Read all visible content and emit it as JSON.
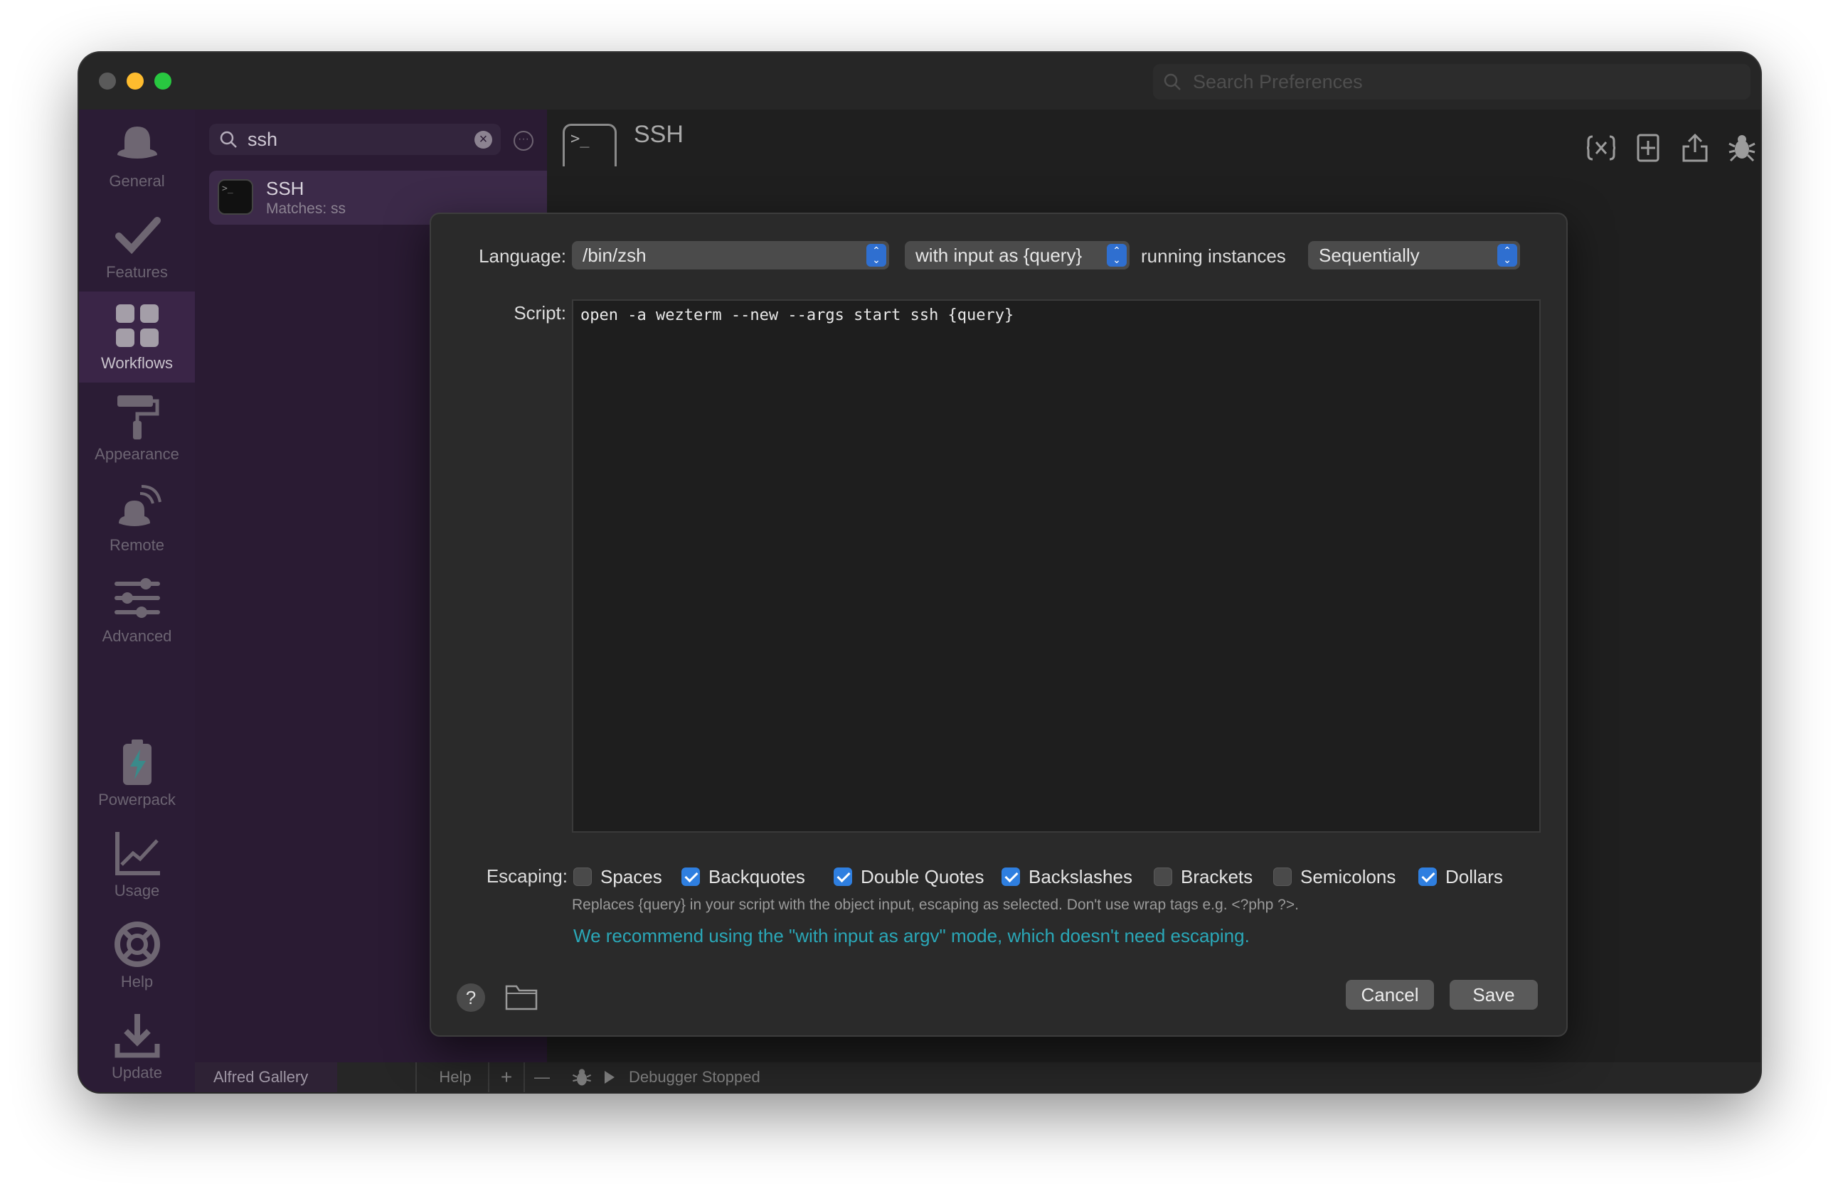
{
  "window": {
    "search_placeholder": "Search Preferences"
  },
  "sidebar": {
    "items": [
      {
        "label": "General",
        "icon": "hat-icon"
      },
      {
        "label": "Features",
        "icon": "checkmark-icon"
      },
      {
        "label": "Workflows",
        "icon": "grid-icon"
      },
      {
        "label": "Appearance",
        "icon": "paint-roller-icon"
      },
      {
        "label": "Remote",
        "icon": "remote-icon"
      },
      {
        "label": "Advanced",
        "icon": "sliders-icon"
      },
      {
        "label": "Powerpack",
        "icon": "battery-bolt-icon"
      },
      {
        "label": "Usage",
        "icon": "chart-icon"
      },
      {
        "label": "Help",
        "icon": "lifebuoy-icon"
      },
      {
        "label": "Update",
        "icon": "download-icon"
      }
    ]
  },
  "workflows": {
    "search_value": "ssh",
    "selected": {
      "title": "SSH",
      "subtitle": "Matches: ss"
    }
  },
  "editor": {
    "title": "SSH",
    "icon_text": ">_"
  },
  "dialog": {
    "language_label": "Language:",
    "language_value": "/bin/zsh",
    "input_mode": "with input as {query}",
    "running_label": "running instances",
    "running_value": "Sequentially",
    "script_label": "Script:",
    "script": "open -a wezterm --new --args start ssh {query}",
    "escaping_label": "Escaping:",
    "escaping": [
      {
        "label": "Spaces",
        "checked": false
      },
      {
        "label": "Backquotes",
        "checked": true
      },
      {
        "label": "Double Quotes",
        "checked": true
      },
      {
        "label": "Backslashes",
        "checked": true
      },
      {
        "label": "Brackets",
        "checked": false
      },
      {
        "label": "Semicolons",
        "checked": false
      },
      {
        "label": "Dollars",
        "checked": true
      }
    ],
    "hint": "Replaces {query} in your script with the object input, escaping as selected. Don't use wrap tags e.g. <?php ?>.",
    "recommend": "We recommend using the \"with input as argv\" mode, which doesn't need escaping.",
    "help_glyph": "?",
    "cancel": "Cancel",
    "save": "Save"
  },
  "bottombar": {
    "gallery": "Alfred Gallery",
    "help": "Help",
    "add": "+",
    "remove": "—",
    "debugger": "Debugger Stopped"
  }
}
